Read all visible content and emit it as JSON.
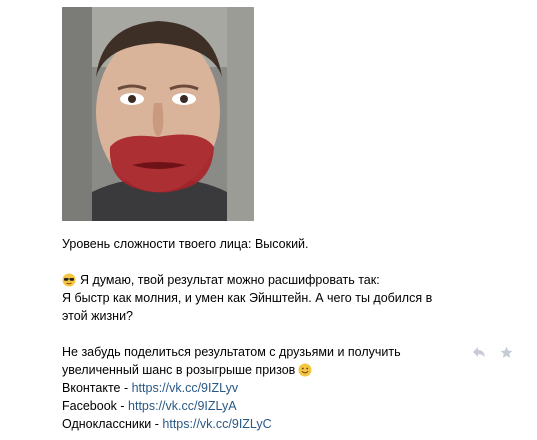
{
  "post": {
    "photo_alt": "user-photo",
    "line1": "Уровень сложности твоего лица: Высокий.",
    "line2_text": "Я думаю, твой результат можно расшифровать так:",
    "line3": "Я быстр как молния, и умен как Эйнштейн. А чего ты добился в",
    "line4": "этой жизни?",
    "line5": "Не забудь поделиться результатом с друзьями и получить",
    "line6": "увеличенный шанс в розыгрыше призов",
    "links": [
      {
        "label": "Вконтакте - ",
        "url": "https://vk.cc/9IZLyv"
      },
      {
        "label": "Facebook - ",
        "url": "https://vk.cc/9IZLyA"
      },
      {
        "label": "Одноклассники - ",
        "url": "https://vk.cc/9IZLyC"
      }
    ]
  },
  "icons": {
    "sunglasses": "sunglasses-emoji-icon",
    "smile": "smile-emoji-icon",
    "reply": "reply-arrow-icon",
    "star": "star-icon"
  },
  "colors": {
    "link": "#2a5885",
    "icon_gray": "#c5ccd5",
    "text": "#000000"
  }
}
